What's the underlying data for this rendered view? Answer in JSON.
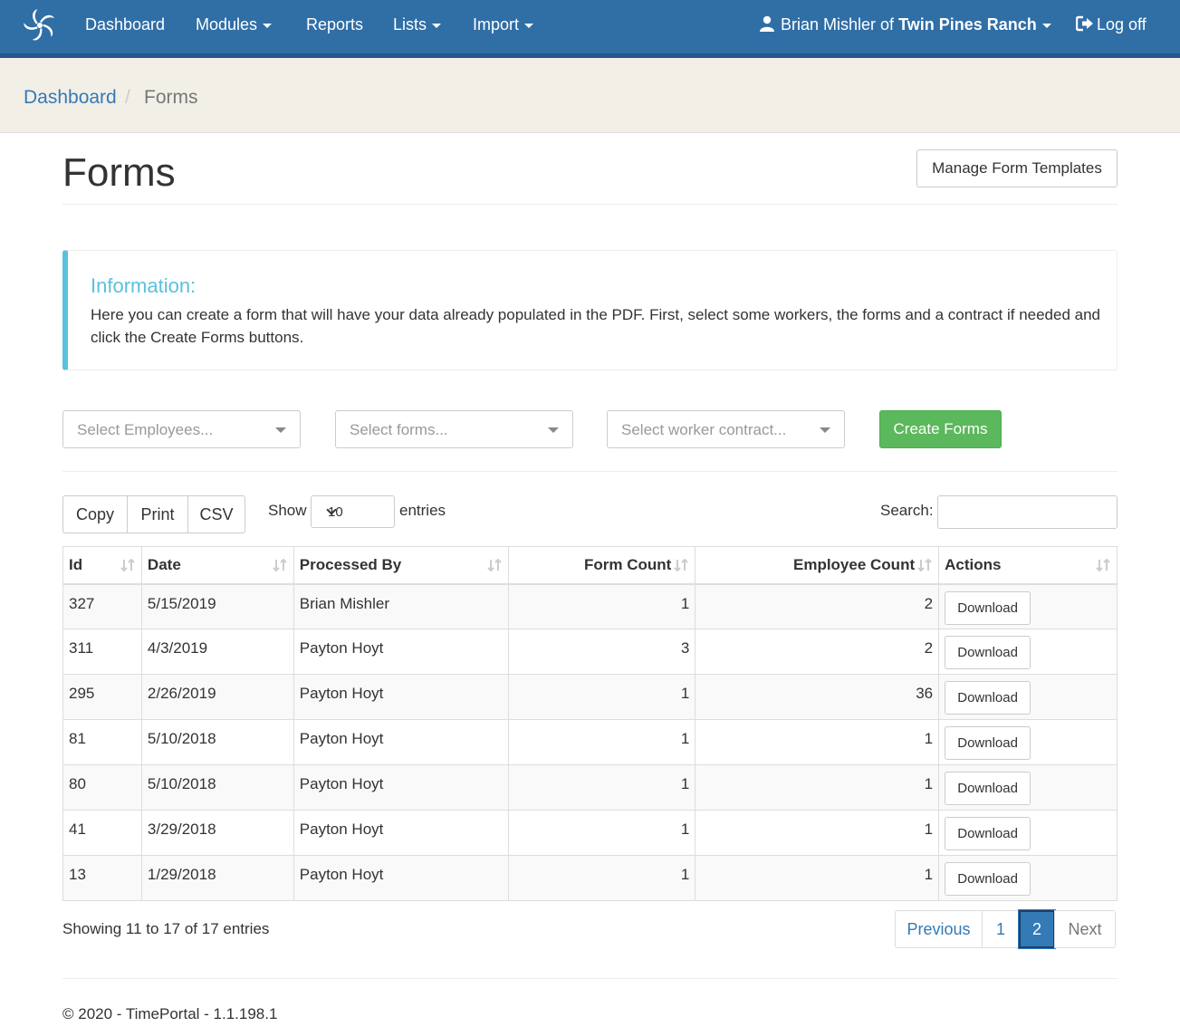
{
  "nav": {
    "items": [
      {
        "label": "Dashboard"
      },
      {
        "label": "Modules"
      },
      {
        "label": "Reports"
      },
      {
        "label": "Lists"
      },
      {
        "label": "Import"
      }
    ],
    "user_name": "Brian Mishler",
    "user_of": "of",
    "user_org": "Twin Pines Ranch",
    "logoff": "Log off"
  },
  "breadcrumb": {
    "home": "Dashboard",
    "separator": "/",
    "current": "Forms"
  },
  "page": {
    "title": "Forms",
    "manage_button": "Manage Form Templates"
  },
  "info": {
    "title": "Information:",
    "text": "Here you can create a form that will have your data already populated in the PDF. First, select some workers, the forms and a contract if needed and click the Create Forms buttons."
  },
  "filters": {
    "employees_placeholder": "Select Employees...",
    "forms_placeholder": "Select forms...",
    "contract_placeholder": "Select worker contract...",
    "create_button": "Create Forms"
  },
  "table_tools": {
    "export_buttons": [
      "Copy",
      "Print",
      "CSV"
    ],
    "show_label": "Show",
    "entries_value": "10",
    "entries_label": "entries",
    "search_label": "Search:"
  },
  "table": {
    "columns": [
      "Id",
      "Date",
      "Processed By",
      "Form Count",
      "Employee Count",
      "Actions"
    ],
    "rows": [
      {
        "id": "327",
        "date": "5/15/2019",
        "processed_by": "Brian Mishler",
        "form_count": "1",
        "employee_count": "2",
        "action": "Download"
      },
      {
        "id": "311",
        "date": "4/3/2019",
        "processed_by": "Payton Hoyt",
        "form_count": "3",
        "employee_count": "2",
        "action": "Download"
      },
      {
        "id": "295",
        "date": "2/26/2019",
        "processed_by": "Payton Hoyt",
        "form_count": "1",
        "employee_count": "36",
        "action": "Download"
      },
      {
        "id": "81",
        "date": "5/10/2018",
        "processed_by": "Payton Hoyt",
        "form_count": "1",
        "employee_count": "1",
        "action": "Download"
      },
      {
        "id": "80",
        "date": "5/10/2018",
        "processed_by": "Payton Hoyt",
        "form_count": "1",
        "employee_count": "1",
        "action": "Download"
      },
      {
        "id": "41",
        "date": "3/29/2018",
        "processed_by": "Payton Hoyt",
        "form_count": "1",
        "employee_count": "1",
        "action": "Download"
      },
      {
        "id": "13",
        "date": "1/29/2018",
        "processed_by": "Payton Hoyt",
        "form_count": "1",
        "employee_count": "1",
        "action": "Download"
      }
    ]
  },
  "pagination": {
    "summary": "Showing 11 to 17 of 17 entries",
    "previous": "Previous",
    "pages": [
      "1",
      "2"
    ],
    "active_page": "2",
    "next": "Next"
  },
  "footer": {
    "copyright": "© 2020 - TimePortal - 1.1.198.1"
  },
  "colors": {
    "navbar": "#306ea6",
    "link": "#337ab7",
    "success": "#5cb85c",
    "info": "#5bc0de"
  }
}
